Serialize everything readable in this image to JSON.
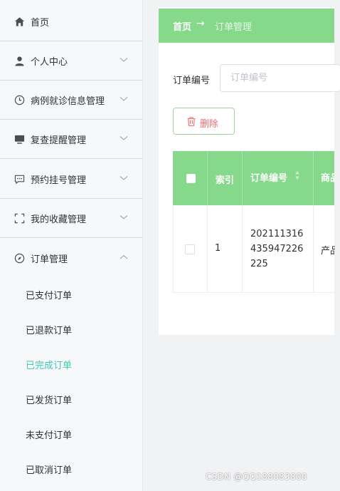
{
  "sidebar": {
    "items": [
      {
        "label": "首页",
        "icon": "home-icon",
        "expandable": false
      },
      {
        "label": "个人中心",
        "icon": "user-icon",
        "expandable": true
      },
      {
        "label": "病例就诊信息管理",
        "icon": "clock-icon",
        "expandable": true
      },
      {
        "label": "复查提醒管理",
        "icon": "monitor-icon",
        "expandable": true
      },
      {
        "label": "预约挂号管理",
        "icon": "chat-icon",
        "expandable": true
      },
      {
        "label": "我的收藏管理",
        "icon": "fullscreen-icon",
        "expandable": true
      },
      {
        "label": "订单管理",
        "icon": "compass-icon",
        "expandable": true,
        "expanded": true
      }
    ],
    "sub_items": [
      {
        "label": "已支付订单",
        "active": false
      },
      {
        "label": "已退款订单",
        "active": false
      },
      {
        "label": "已完成订单",
        "active": true
      },
      {
        "label": "已发货订单",
        "active": false
      },
      {
        "label": "未支付订单",
        "active": false
      },
      {
        "label": "已取消订单",
        "active": false
      }
    ]
  },
  "breadcrumb": {
    "home": "首页",
    "separator": "→",
    "current": "订单管理"
  },
  "search": {
    "label": "订单编号",
    "placeholder": "订单编号",
    "value": ""
  },
  "toolbar": {
    "delete_label": "删除"
  },
  "table": {
    "headers": {
      "index": "索引",
      "order_no": "订单编号",
      "product": "商品"
    },
    "rows": [
      {
        "index": "1",
        "order_no_lines": [
          "202111316",
          "435947226",
          "225"
        ],
        "product": "产品"
      }
    ]
  },
  "watermark": "CSDN @QQ188083800",
  "colors": {
    "accent_green": "#86d88a",
    "active_teal": "#3ec7b5",
    "danger": "#f56c6c"
  }
}
